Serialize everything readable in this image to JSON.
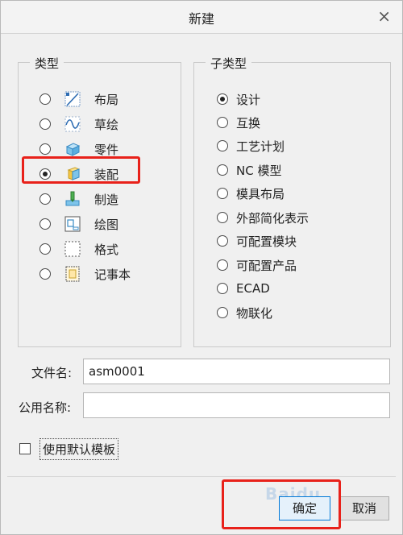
{
  "dialog": {
    "title": "新建",
    "close_glyph": "×"
  },
  "type_group": {
    "legend": "类型",
    "items": [
      {
        "label": "布局",
        "icon": "layout-icon",
        "checked": false
      },
      {
        "label": "草绘",
        "icon": "sketch-icon",
        "checked": false
      },
      {
        "label": "零件",
        "icon": "part-icon",
        "checked": false
      },
      {
        "label": "装配",
        "icon": "assembly-icon",
        "checked": true
      },
      {
        "label": "制造",
        "icon": "manufacturing-icon",
        "checked": false
      },
      {
        "label": "绘图",
        "icon": "drawing-icon",
        "checked": false
      },
      {
        "label": "格式",
        "icon": "format-icon",
        "checked": false
      },
      {
        "label": "记事本",
        "icon": "notebook-icon",
        "checked": false
      }
    ]
  },
  "subtype_group": {
    "legend": "子类型",
    "items": [
      {
        "label": "设计",
        "checked": true
      },
      {
        "label": "互换",
        "checked": false
      },
      {
        "label": "工艺计划",
        "checked": false
      },
      {
        "label": "NC 模型",
        "checked": false
      },
      {
        "label": "模具布局",
        "checked": false
      },
      {
        "label": "外部简化表示",
        "checked": false
      },
      {
        "label": "可配置模块",
        "checked": false
      },
      {
        "label": "可配置产品",
        "checked": false
      },
      {
        "label": "ECAD",
        "checked": false
      },
      {
        "label": "物联化",
        "checked": false
      }
    ]
  },
  "fields": {
    "filename_label": "文件名:",
    "filename_value": "asm0001",
    "common_name_label": "公用名称:",
    "common_name_value": ""
  },
  "use_default_template": {
    "label": "使用默认模板",
    "checked": false
  },
  "buttons": {
    "ok": "确定",
    "cancel": "取消"
  },
  "watermark": "Baidu",
  "colors": {
    "highlight": "#e8211a",
    "accent": "#0078d7"
  }
}
